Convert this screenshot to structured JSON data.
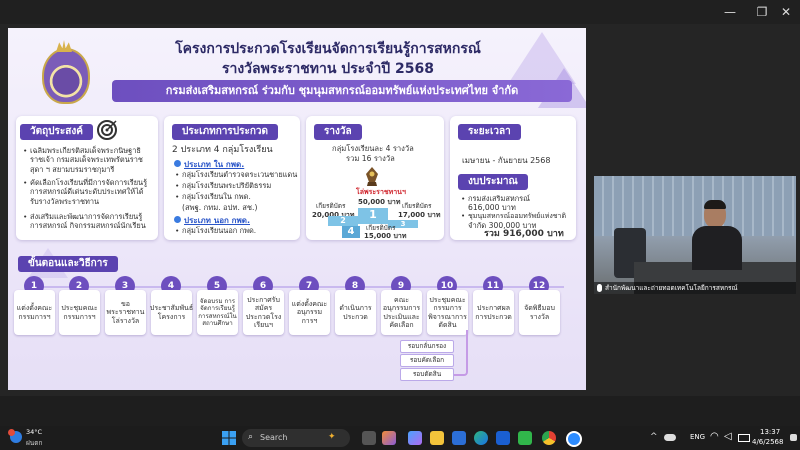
{
  "window": {
    "minimize": "—",
    "maximize": "❐",
    "close": "✕"
  },
  "slide": {
    "title_line1": "โครงการประกวดโรงเรียนจัดการเรียนรู้การสหกรณ์",
    "title_line2": "รางวัลพระราชทาน ประจำปี 2568",
    "banner": "กรมส่งเสริมสหกรณ์ ร่วมกับ ชุมนุมสหกรณ์ออมทรัพย์แห่งประเทศไทย จำกัด",
    "objective": {
      "heading": "วัตถุประสงค์",
      "items": [
        "เฉลิมพระเกียรติสมเด็จพระกนิษฐาธิราชเจ้า กรมสมเด็จพระเทพรัตนราชสุดา ฯ สยามบรมราชกุมารี",
        "คัดเลือกโรงเรียนที่มีการจัดการเรียนรู้การสหกรณ์ดีเด่นระดับประเทศให้ได้รับรางวัลพระราชทาน",
        "ส่งเสริมและพัฒนาการจัดการเรียนรู้การสหกรณ์ กิจกรรมสหกรณ์นักเรียน"
      ]
    },
    "categories": {
      "heading": "ประเภทการประกวด",
      "summary": "2 ประเภท 4 กลุ่มโรงเรียน",
      "type_a": "ประเภท ใน กพด.",
      "type_a_items": [
        "กลุ่มโรงเรียนตำรวจตระเวนชายแดน",
        "กลุ่มโรงเรียนพระปริยัติธรรม",
        "กลุ่มโรงเรียนใน กพด.",
        "(สพฐ. กทม. อปท. สช.)"
      ],
      "type_b": "ประเภท นอก กพด.",
      "type_b_items": [
        "กลุ่มโรงเรียนนอก กพด."
      ]
    },
    "award": {
      "heading": "รางวัล",
      "line1": "กลุ่มโรงเรียนละ 4 รางวัล",
      "line2": "รวม 16 รางวัล",
      "trophy_label": "โล่พระราชทานฯ",
      "first_prize": "50,000 บาท",
      "second_label": "เกียรติบัตร",
      "second_prize": "20,000 บาท",
      "third_label": "เกียรติบัตร",
      "third_prize": "17,000 บาท",
      "fourth_label": "เกียรติบัตร",
      "fourth_prize": "15,000 บาท",
      "rank1": "1",
      "rank2": "2",
      "rank3": "3",
      "rank4": "4"
    },
    "period": {
      "heading": "ระยะเวลา",
      "value": "เมษายน - กันยายน 2568"
    },
    "budget": {
      "heading": "งบประมาณ",
      "items": [
        "กรมส่งเสริมสหกรณ์",
        "616,000 บาท",
        "ชุมนุมสหกรณ์ออมทรัพย์แห่งชาติ",
        "จำกัด 300,000 บาท"
      ],
      "total": "รวม 916,000 บาท"
    },
    "steps_heading": "ขั้นตอนและวิธีการ",
    "steps": [
      {
        "num": "1",
        "label": "แต่งตั้งคณะกรรมการฯ"
      },
      {
        "num": "2",
        "label": "ประชุมคณะกรรมการฯ"
      },
      {
        "num": "3",
        "label": "ขอพระราชทานโล่รางวัล"
      },
      {
        "num": "4",
        "label": "ประชาสัมพันธ์โครงการ"
      },
      {
        "num": "5",
        "label": "จัดอบรม การจัดการเรียนรู้การสหกรณ์ในสถานศึกษา"
      },
      {
        "num": "6",
        "label": "ประกาศรับสมัครประกวดโรงเรียนฯ"
      },
      {
        "num": "7",
        "label": "แต่งตั้งคณะอนุกรรมการฯ"
      },
      {
        "num": "8",
        "label": "ดำเนินการประกวด"
      },
      {
        "num": "9",
        "label": "คณะอนุกรรมการประเมินและคัดเลือก"
      },
      {
        "num": "10",
        "label": "ประชุมคณะกรรมการพิจารณาการตัดสิน"
      },
      {
        "num": "11",
        "label": "ประกาศผลการประกวด"
      },
      {
        "num": "12",
        "label": "จัดพิธีมอบรางวัล"
      }
    ],
    "sub_steps": [
      "รอบกลั่นกรอง",
      "รอบคัดเลือก",
      "รอบตัดสิน"
    ]
  },
  "camera": {
    "caption": "สำนักพัฒนาและถ่ายทอดเทคโนโลยีการสหกรณ์"
  },
  "taskbar": {
    "weather_temp": "34°C",
    "weather_text": "ฝนตก",
    "search_placeholder": "Search",
    "lang": "ENG",
    "time": "13:37",
    "date": "4/6/2568"
  },
  "colors": {
    "accent": "#5b43b0",
    "banner": "#6d4fbf",
    "podium": "#7ec3e6"
  }
}
